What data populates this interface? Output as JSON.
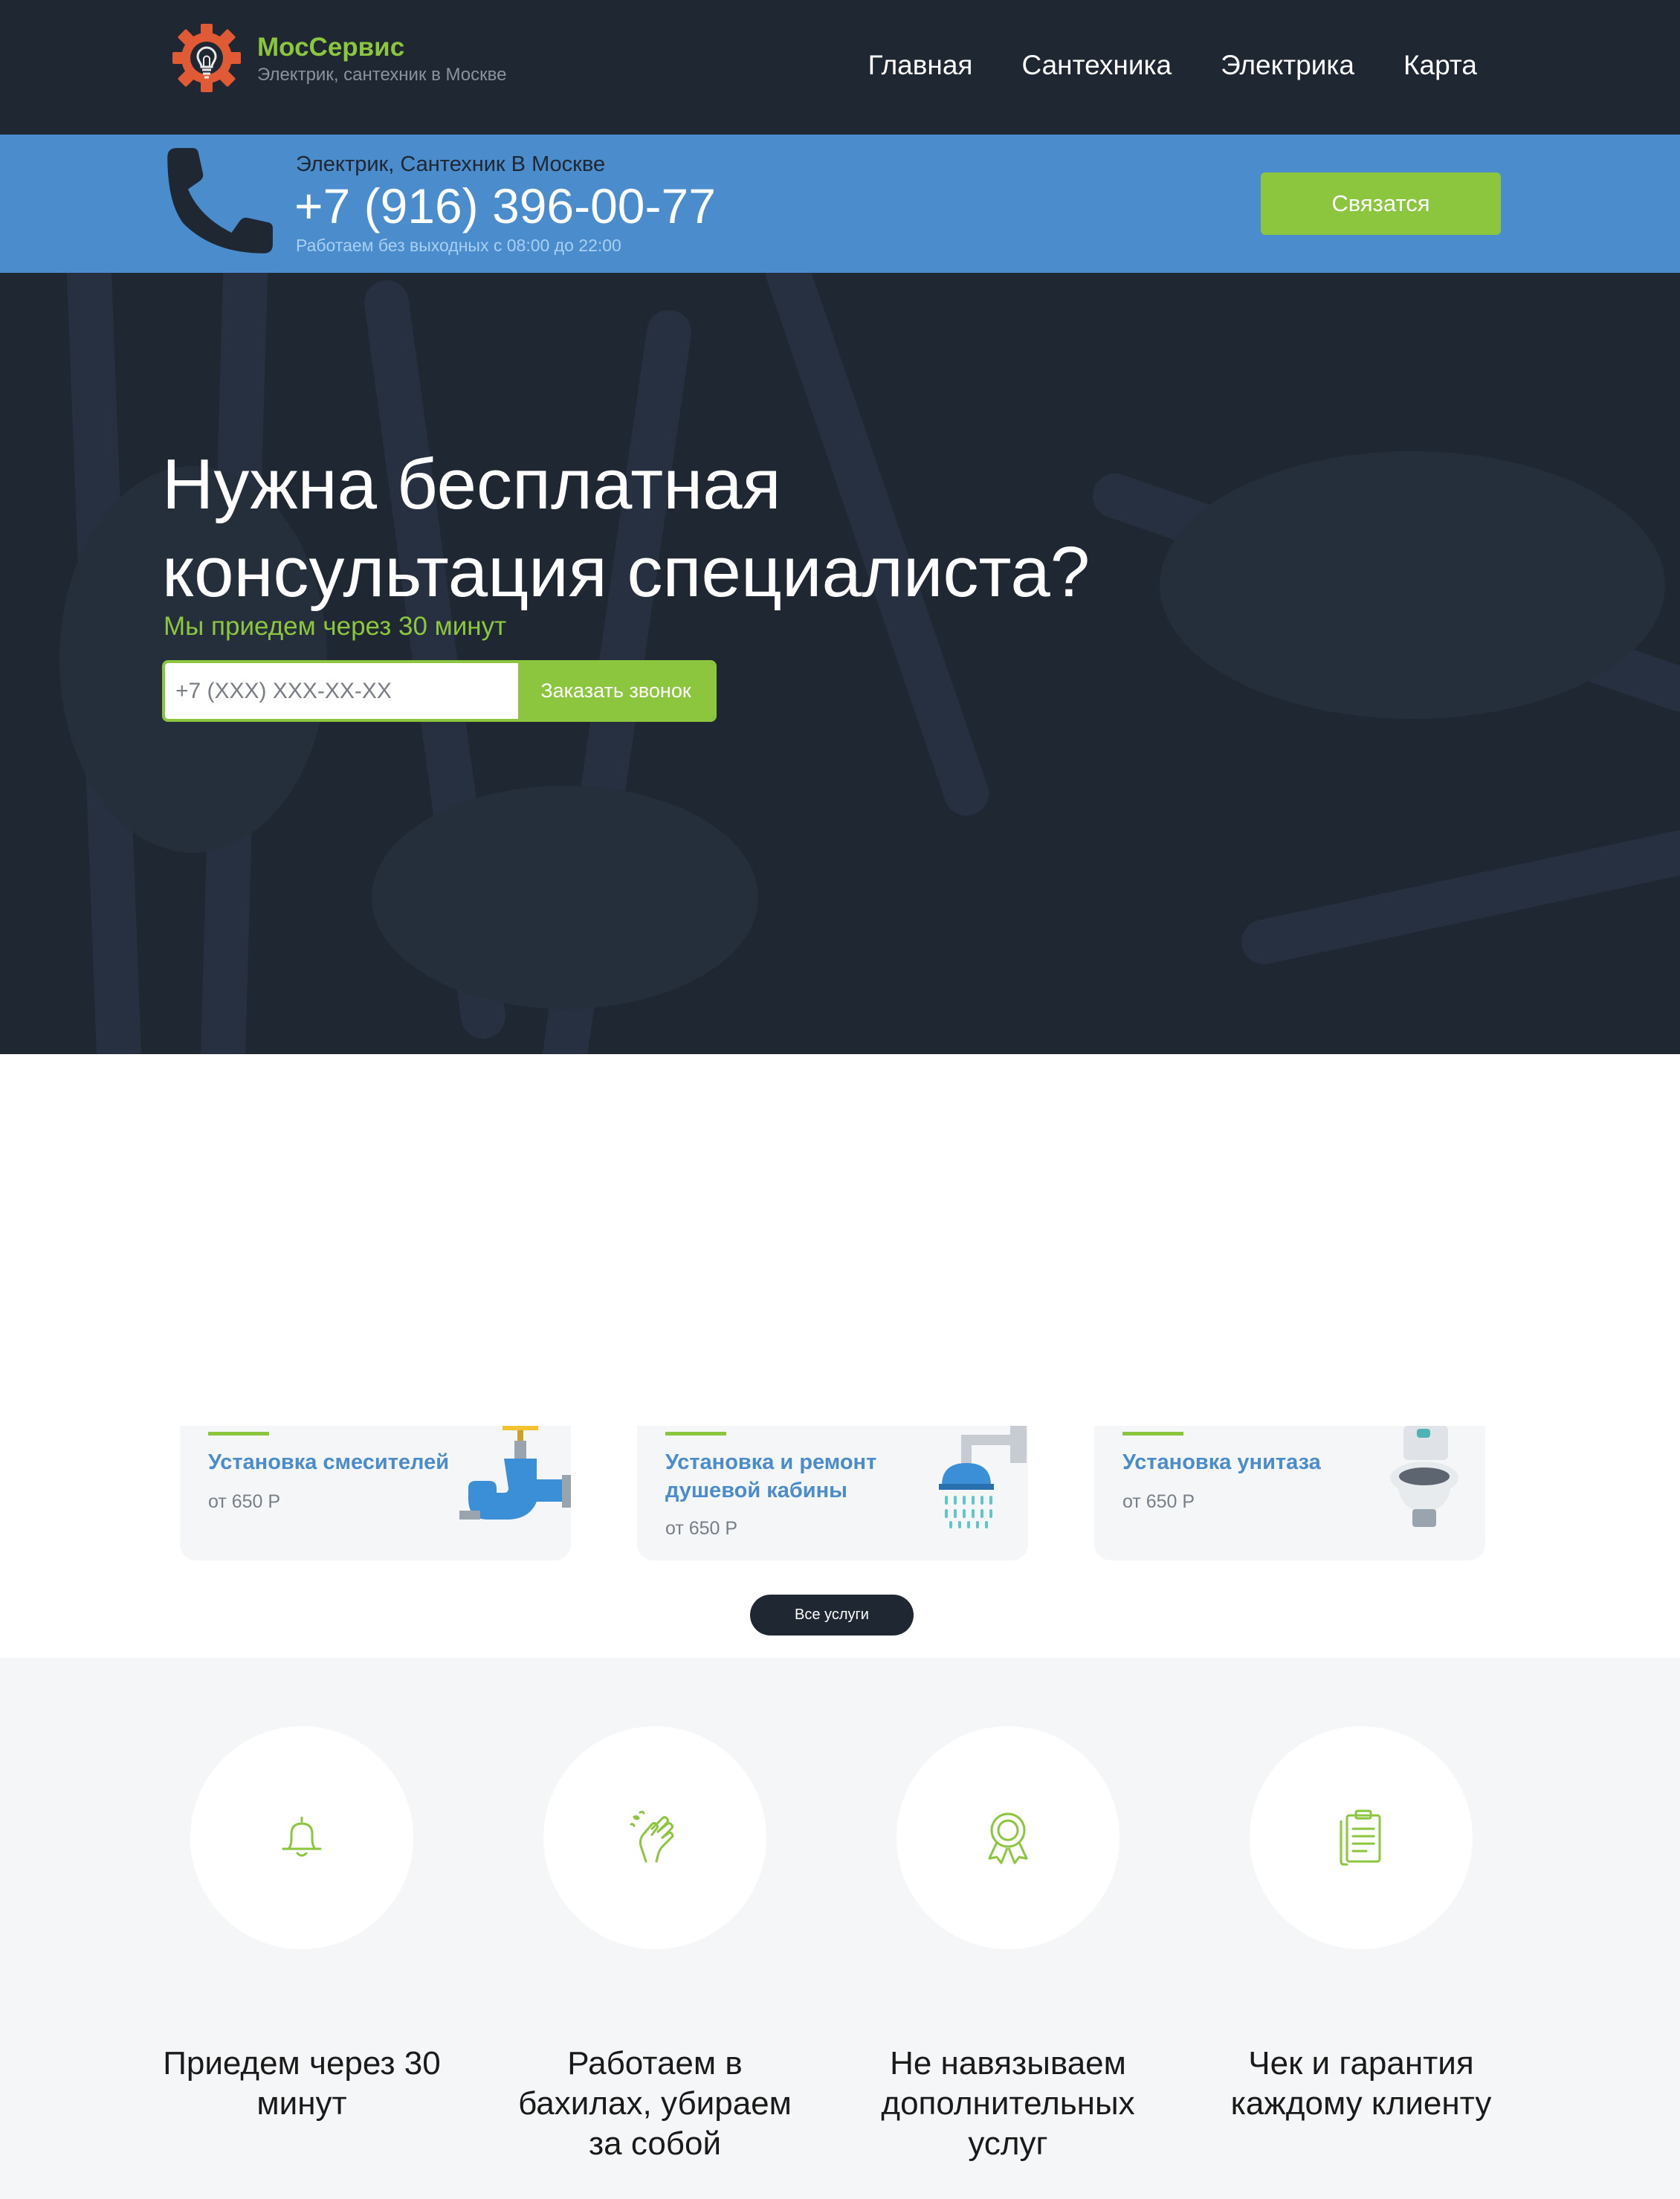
{
  "header": {
    "brand_name": "МосСервис",
    "brand_tagline": "Электрик, сантехник в Москве",
    "logo_icon": "gear-lightbulb-icon",
    "nav": [
      "Главная",
      "Сантехника",
      "Электрика",
      "Карта"
    ]
  },
  "phone_strip": {
    "icon": "phone-handset-icon",
    "label": "Электрик, Сантехник В Москве",
    "phone": "+7 (916) 396-00-77",
    "hours": "Работаем без выходных с 08:00 до 22:00",
    "contact_button": "Связатся"
  },
  "hero": {
    "title_line1": "Нужна бесплатная",
    "title_line2": "консультация специалиста?",
    "subtitle": "Мы приедем через 30 минут",
    "phone_placeholder": "+7 (XXX) XXX-XX-XX",
    "call_button": "Заказать звонок"
  },
  "services": {
    "items": [
      {
        "title": "Установка смесителей",
        "price": "от 650 Р",
        "icon": "faucet-icon"
      },
      {
        "title": "Установка и ремонт душевой кабины",
        "price": "от 650 Р",
        "icon": "shower-icon"
      },
      {
        "title": "Установка унитаза",
        "price": "от 650 Р",
        "icon": "toilet-icon"
      }
    ],
    "all_button": "Все услуги"
  },
  "benefits": [
    {
      "icon": "bell-icon",
      "text": "Приедем через 30 минут"
    },
    {
      "icon": "clean-hands-icon",
      "text": "Работаем в бахилах, убираем за собой"
    },
    {
      "icon": "award-icon",
      "text": "Не навязываем дополнительных услуг"
    },
    {
      "icon": "receipt-icon",
      "text": "Чек и гарантия каждому клиенту"
    }
  ],
  "colors": {
    "dark": "#1f2732",
    "accent_green": "#8cc63f",
    "accent_blue": "#4a8ccc",
    "logo_orange": "#e05a36"
  }
}
